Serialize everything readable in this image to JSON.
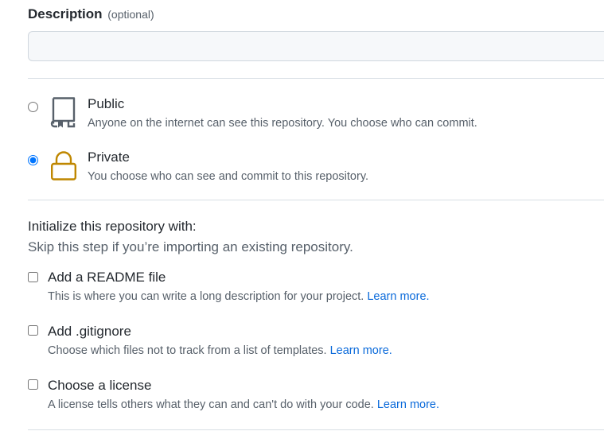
{
  "description": {
    "label": "Description",
    "optional_label": "(optional)",
    "value": "",
    "placeholder": ""
  },
  "visibility": {
    "options": [
      {
        "title": "Public",
        "note": "Anyone on the internet can see this repository. You choose who can commit.",
        "icon": "repo-icon",
        "selected": false
      },
      {
        "title": "Private",
        "note": "You choose who can see and commit to this repository.",
        "icon": "lock-icon",
        "selected": true
      }
    ]
  },
  "initialize": {
    "heading": "Initialize this repository with:",
    "subheading": "Skip this step if you’re importing an existing repository.",
    "options": [
      {
        "title": "Add a README file",
        "note": "This is where you can write a long description for your project.",
        "link": "Learn more.",
        "checked": false
      },
      {
        "title": "Add .gitignore",
        "note": "Choose which files not to track from a list of templates.",
        "link": "Learn more.",
        "checked": false
      },
      {
        "title": "Choose a license",
        "note": "A license tells others what they can and can't do with your code.",
        "link": "Learn more.",
        "checked": false
      }
    ]
  },
  "colors": {
    "text": "#24292f",
    "muted": "#57606a",
    "link": "#0969da",
    "lock": "#bf8700",
    "border": "#d0d7de"
  }
}
